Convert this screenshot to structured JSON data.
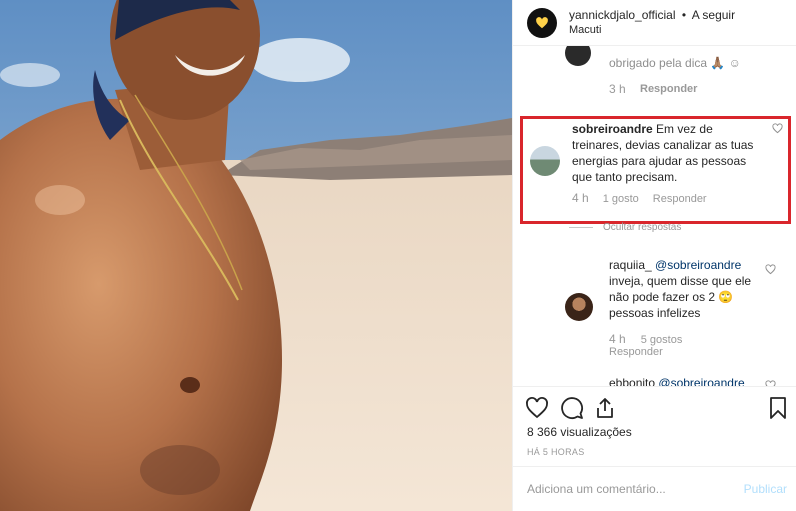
{
  "header": {
    "username": "yannickdjalo_official",
    "separator": "•",
    "follow": "A seguir",
    "location": "Macuti"
  },
  "previous_comment": {
    "text": "obrigado pela dica 🙏🏽 ☺",
    "time": "3 h",
    "reply": "Responder"
  },
  "highlighted_comment": {
    "username": "sobreiroandre",
    "text": "Em vez de treinares, devias canalizar as tuas energias para ajudar as pessoas que tanto precisam.",
    "time": "4 h",
    "likes": "1 gosto",
    "reply": "Responder"
  },
  "hide_replies": "Ocultar respostas",
  "reply_1": {
    "username": "raquiia_",
    "mention": "@sobreiroandre",
    "text": "inveja, quem disse que ele não pode fazer os 2 🙄 pessoas infelizes",
    "time": "4 h",
    "likes": "5 gostos",
    "reply": "Responder"
  },
  "reply_2": {
    "username": "ebbonito",
    "mention": "@sobreiroandre"
  },
  "stats": {
    "views": "8 366 visualizações",
    "time_ago": "HÁ 5 HORAS"
  },
  "add_comment": {
    "placeholder": "Adiciona um comentário...",
    "publish": "Publicar"
  },
  "colors": {
    "highlight_border": "#d9262c",
    "mention": "#003569",
    "publish_disabled": "#b2dffc"
  },
  "icons": [
    "heart-icon",
    "comment-icon",
    "share-icon",
    "bookmark-icon"
  ]
}
